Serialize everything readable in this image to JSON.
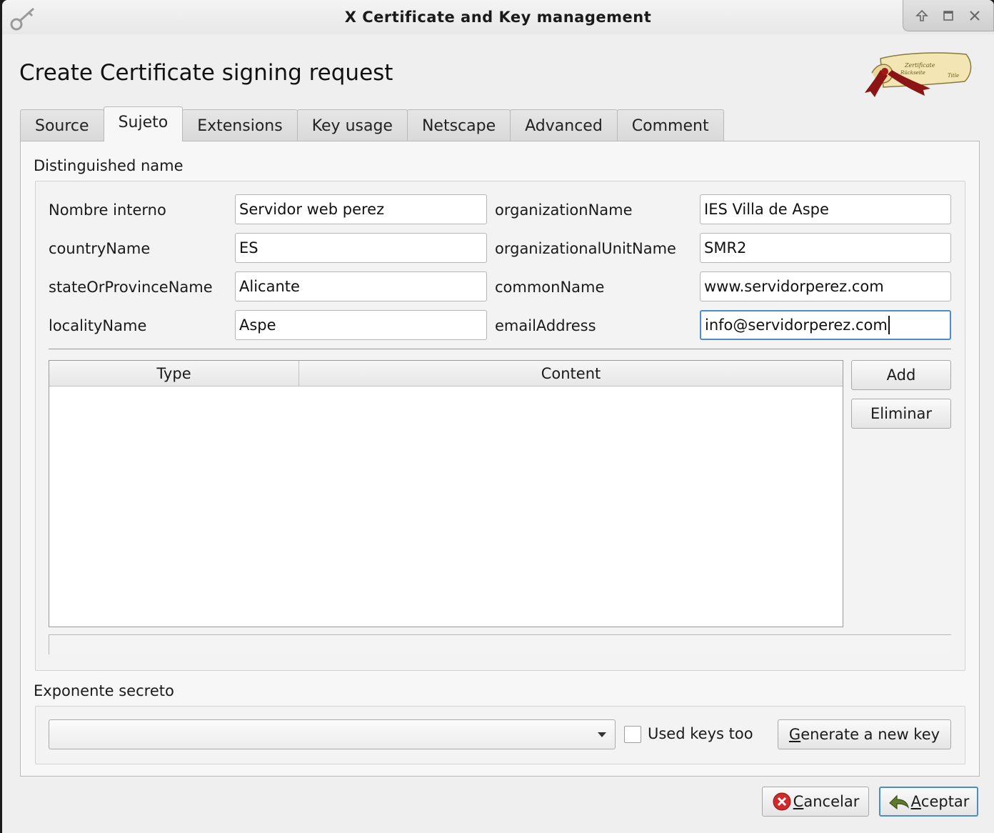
{
  "window": {
    "title": "X Certificate and Key management",
    "icon": "key-icon"
  },
  "header": {
    "title": "Create Certificate signing request",
    "logo": "certificate-scroll-logo"
  },
  "tabs": [
    {
      "label": "Source",
      "active": false
    },
    {
      "label": "Sujeto",
      "active": true
    },
    {
      "label": "Extensions",
      "active": false
    },
    {
      "label": "Key usage",
      "active": false
    },
    {
      "label": "Netscape",
      "active": false
    },
    {
      "label": "Advanced",
      "active": false
    },
    {
      "label": "Comment",
      "active": false
    }
  ],
  "distinguished_name": {
    "group_title": "Distinguished name",
    "fields": {
      "internal_name": {
        "label": "Nombre interno",
        "value": "Servidor web perez"
      },
      "country": {
        "label": "countryName",
        "value": "ES"
      },
      "state": {
        "label": "stateOrProvinceName",
        "value": "Alicante"
      },
      "locality": {
        "label": "localityName",
        "value": "Aspe"
      },
      "organization": {
        "label": "organizationName",
        "value": "IES Villa de Aspe"
      },
      "org_unit": {
        "label": "organizationalUnitName",
        "value": "SMR2"
      },
      "common_name": {
        "label": "commonName",
        "value": "www.servidorperez.com"
      },
      "email": {
        "label": "emailAddress",
        "value": "info@servidorperez.com"
      }
    },
    "table": {
      "columns": [
        "Type",
        "Content"
      ],
      "rows": []
    },
    "add_label": "Add",
    "remove_label": "Eliminar"
  },
  "private_key": {
    "group_title": "Exponente secreto",
    "selected": "",
    "used_keys_label": "Used keys too",
    "used_keys_checked": false,
    "generate_label_mnemonic": "G",
    "generate_label_rest": "enerate a new key"
  },
  "footer": {
    "cancel_mnemonic": "C",
    "cancel_rest": "ancelar",
    "ok_mnemonic": "A",
    "ok_rest": "ceptar"
  }
}
